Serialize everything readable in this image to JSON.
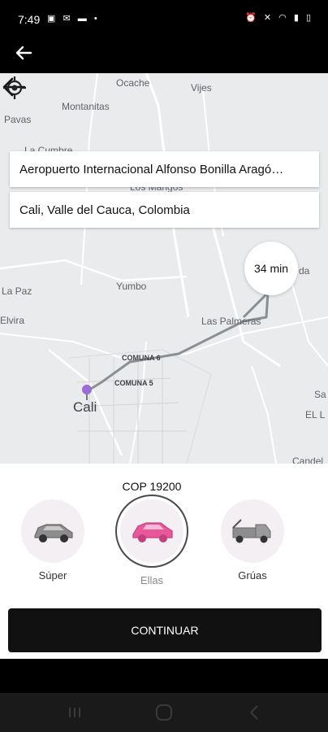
{
  "status_bar": {
    "time": "7:49",
    "left_icons": [
      "gallery-icon",
      "mail-icon",
      "message-icon",
      "dot-icon"
    ],
    "right_icons": [
      "alarm-icon",
      "mute-icon",
      "wifi-icon",
      "signal-icon",
      "battery-icon"
    ]
  },
  "map": {
    "labels": {
      "ocache": "Ocache",
      "vijes": "Vijes",
      "montanitas": "Montanitas",
      "pavas": "Pavas",
      "la_cumbre": "La Cumbre",
      "los_mangos": "Los Mangos",
      "la_paz": "La Paz",
      "elvira": "Elvira",
      "yumbo": "Yumbo",
      "las_palmeras": "Las Palmeras",
      "comuna_6": "COMUNA 6",
      "comuna_5": "COMUNA 5",
      "cali": "Cali",
      "sa": "Sa",
      "el_l": "EL L",
      "candel": "Candel",
      "da": "da"
    },
    "origin": "Aeropuerto Internacional Alfonso Bonilla Aragó…",
    "destination": "Cali, Valle del Cauca, Colombia",
    "eta": "34 min"
  },
  "sheet": {
    "price": "COP 19200",
    "vehicles": [
      {
        "name": "Súper",
        "icon": "sedan-car-icon",
        "selected": false
      },
      {
        "name": "Ellas",
        "icon": "pink-car-icon",
        "selected": true
      },
      {
        "name": "Grúas",
        "icon": "tow-truck-icon",
        "selected": false
      }
    ],
    "continue_label": "CONTINUAR"
  },
  "nav_bar": {
    "buttons": [
      "recents-icon",
      "home-icon",
      "back-icon"
    ]
  },
  "colors": {
    "accent_pink": "#e8579a",
    "route": "#8a8f94",
    "pin": "#9b6bd6"
  }
}
